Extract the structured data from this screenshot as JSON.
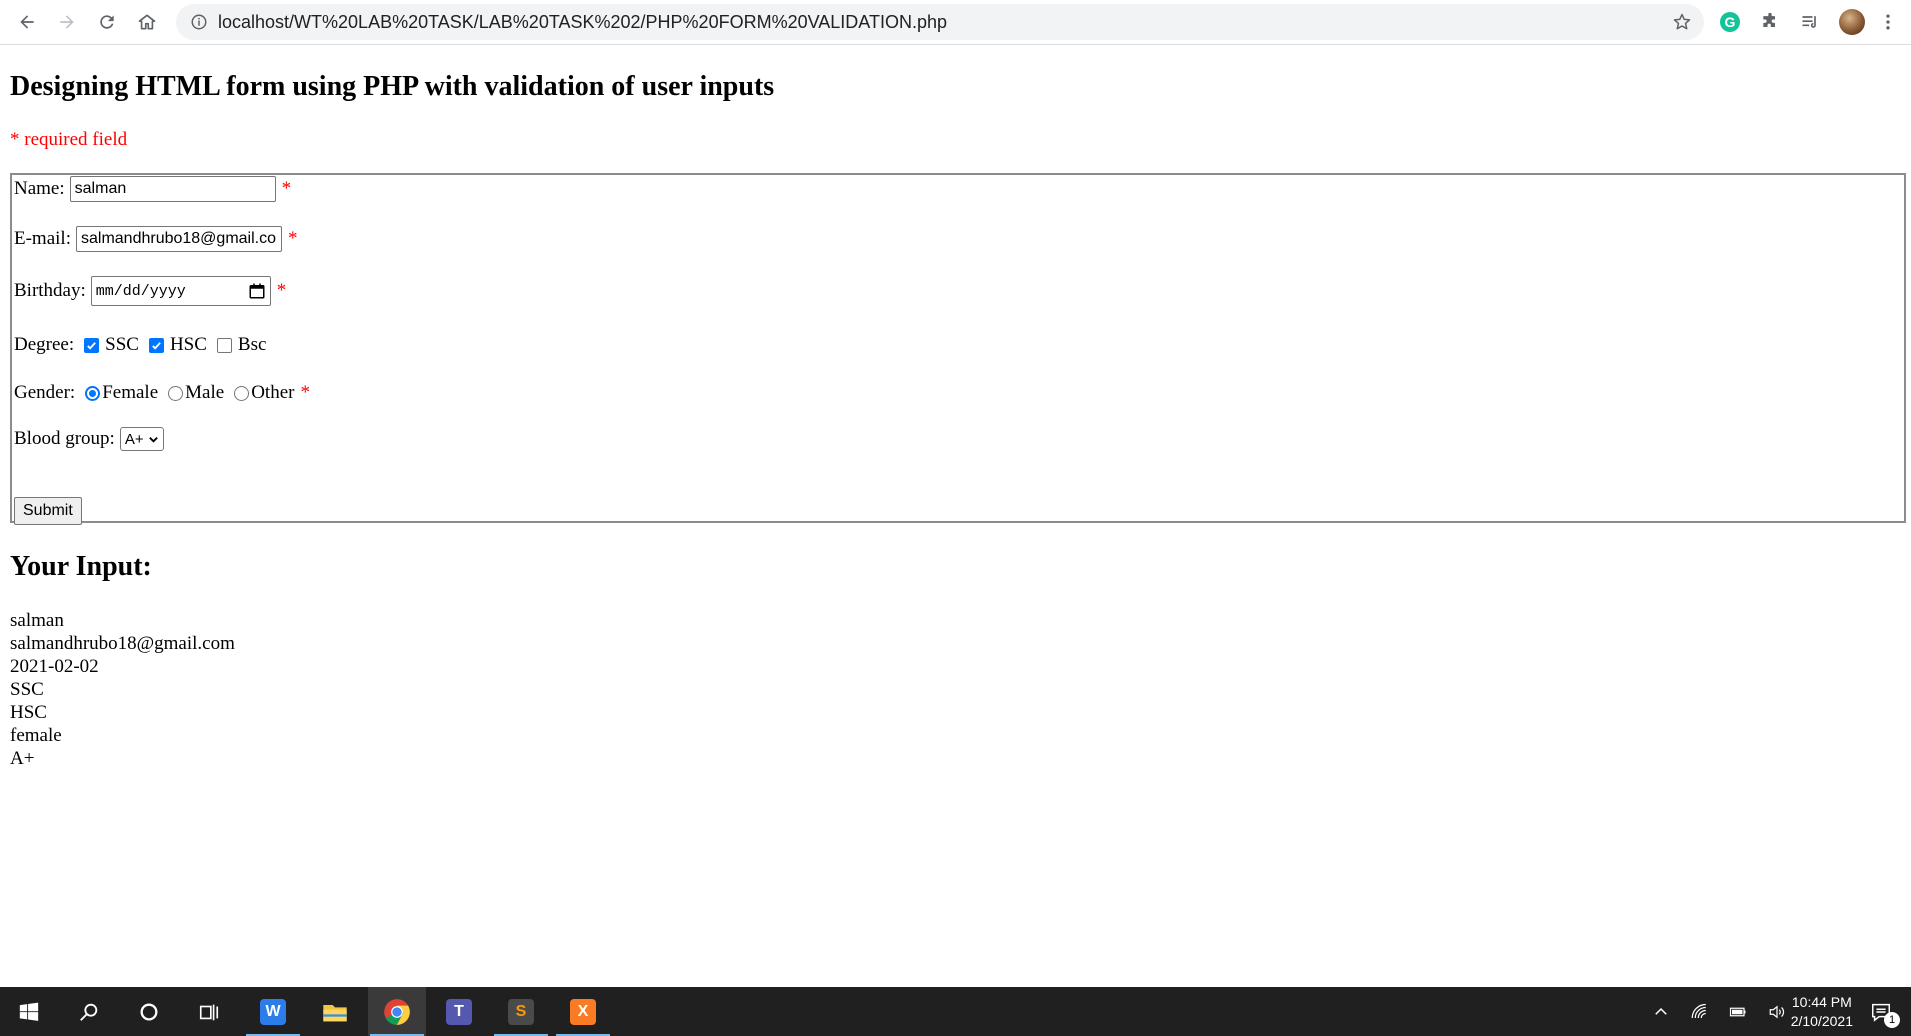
{
  "browser": {
    "url": "localhost/WT%20LAB%20TASK/LAB%20TASK%202/PHP%20FORM%20VALIDATION.php",
    "nav_icons": [
      "back-icon",
      "forward-icon",
      "reload-icon",
      "home-icon"
    ],
    "extension_icons": [
      "grammarly-icon",
      "extensions-puzzle-icon",
      "reading-list-icon",
      "profile-avatar",
      "menu-kebab-icon"
    ]
  },
  "page": {
    "title": "Designing HTML form using PHP with validation of user inputs",
    "required_note": "* required field",
    "form": {
      "name_label": "Name:",
      "name_value": "salman",
      "email_label": "E-mail:",
      "email_value": "salmandhrubo18@gmail.com",
      "birthday_label": "Birthday:",
      "birthday_placeholder": "mm/dd/yyyy",
      "degree_label": "Degree:",
      "degrees": [
        {
          "label": "SSC",
          "checked": true
        },
        {
          "label": "HSC",
          "checked": true
        },
        {
          "label": "Bsc",
          "checked": false
        }
      ],
      "gender_label": "Gender:",
      "genders": [
        {
          "label": "Female",
          "checked": true
        },
        {
          "label": "Male",
          "checked": false
        },
        {
          "label": "Other",
          "checked": false
        }
      ],
      "blood_group_label": "Blood group:",
      "blood_group_value": "A+",
      "required_star": "*",
      "submit_label": "Submit"
    },
    "result_title": "Your Input:",
    "results": [
      "salman",
      "salmandhrubo18@gmail.com",
      "2021-02-02",
      "SSC",
      "HSC",
      "female",
      "A+"
    ]
  },
  "taskbar": {
    "apps": [
      {
        "name": "windows-start-icon"
      },
      {
        "name": "search-icon"
      },
      {
        "name": "cortana-icon"
      },
      {
        "name": "task-view-icon"
      },
      {
        "name": "wps-writer-icon",
        "glyph": "W"
      },
      {
        "name": "file-explorer-icon"
      },
      {
        "name": "chrome-icon"
      },
      {
        "name": "teams-icon",
        "glyph": "T"
      },
      {
        "name": "sublime-text-icon",
        "glyph": "S"
      },
      {
        "name": "xampp-icon",
        "glyph": "X"
      }
    ],
    "time": "10:44 PM",
    "date": "2/10/2021",
    "notification_count": "1"
  },
  "colors": {
    "required_red": "#ff0000",
    "accent_blue": "#0075ff",
    "taskbar_bg": "#202020"
  }
}
